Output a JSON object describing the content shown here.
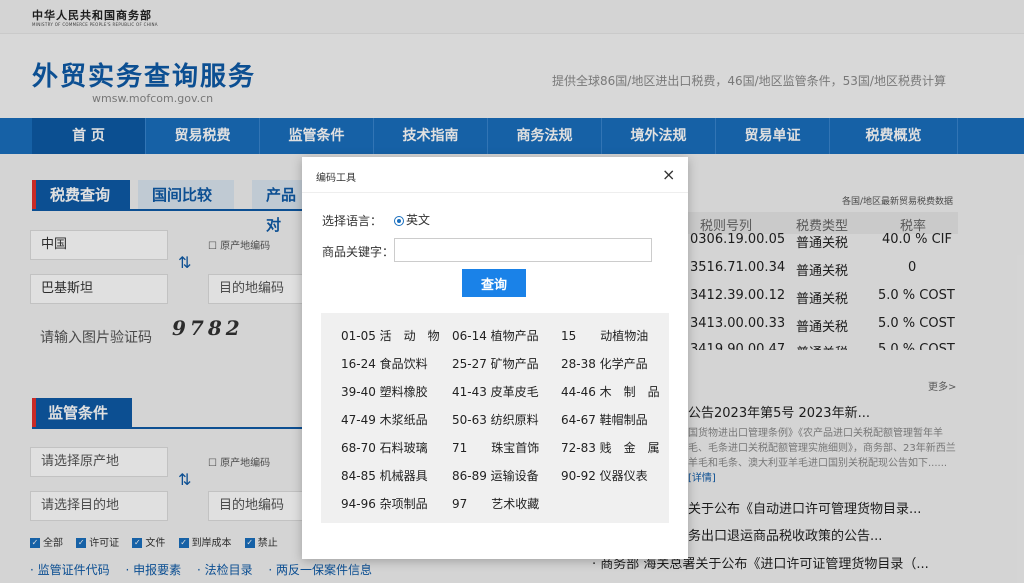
{
  "header": {
    "ministry_cn": "中华人民共和国商务部",
    "ministry_en": "MINISTRY OF COMMERCE PEOPLE'S REPUBLIC OF CHINA",
    "site_title": "外贸实务查询服务",
    "site_domain": "wmsw.mofcom.gov.cn",
    "slogan": "提供全球86国/地区进出口税费，46国/地区监管条件，53国/地区税费计算"
  },
  "nav": [
    "首 页",
    "贸易税费",
    "监管条件",
    "技术指南",
    "商务法规",
    "境外法规",
    "贸易单证",
    "税费概览"
  ],
  "tax_query": {
    "tabs": [
      "税费查询",
      "国间比较",
      "产品对"
    ],
    "origin_value": "中国",
    "origin_code_label": "原产地编码",
    "dest_value": "巴基斯坦",
    "dest_code_label": "目的地编码",
    "captcha_placeholder": "请输入图片验证码",
    "captcha_text": "9782"
  },
  "supervision": {
    "title": "监管条件",
    "origin_placeholder": "请选择原产地",
    "origin_code_label": "原产地编码",
    "dest_placeholder": "请选择目的地",
    "dest_code_label": "目的地编码",
    "checkboxes": [
      "全部",
      "许可证",
      "文件",
      "到岸成本",
      "禁止"
    ],
    "links": [
      "· 监管证件代码",
      "· 申报要素",
      "· 法检目录",
      "· 两反一保案件信息"
    ]
  },
  "right_panel": {
    "note": "各国/地区最新贸易税费数据",
    "table_headers": [
      "税则号列",
      "税费类型",
      "税率"
    ],
    "rows": [
      {
        "code": "0306.19.00.05",
        "type": "普通关税",
        "rate": "40.0 % CIF"
      },
      {
        "code": "3516.71.00.34",
        "type": "普通关税",
        "rate": "0"
      },
      {
        "code": "3412.39.00.12",
        "type": "普通关税",
        "rate": "5.0 % COST"
      },
      {
        "code": "3413.00.00.33",
        "type": "普通关税",
        "rate": "5.0 % COST"
      },
      {
        "code": "3419.90.00.47",
        "type": "普通关税",
        "rate": "5.0 % COST"
      }
    ],
    "more": "更多>",
    "news1_title": "公告2023年第5号 2023年新...",
    "news1_body": "国货物进出口管理条例》《农产品进口关税配额管理暂年羊毛、毛条进口关税配额管理实施细则》，商务部、23年新西兰羊毛和毛条、澳大利亚羊毛进口国别关税配现公告如下......",
    "news1_detail": "[详情]",
    "news2_title": "关于公布《自动进口许可管理货物目录...",
    "news3_title": "务出口退运商品税收政策的公告...",
    "news4_title": "· 商务部 海关总署关于公布《进口许可证管理货物目录（..."
  },
  "modal": {
    "title": "编码工具",
    "close": "×",
    "lang_label": "选择语言：",
    "lang_option": "英文",
    "keyword_label": "商品关键字：",
    "keyword_value": "",
    "keyword_placeholder": "",
    "query_button": "查询",
    "categories": [
      "01-05 活　动　物",
      "06-14 植物产品",
      "15　　动植物油",
      "16-24 食品饮料",
      "25-27 矿物产品",
      "28-38 化学产品",
      "39-40 塑料橡胶",
      "41-43 皮革皮毛",
      "44-46 木　制　品",
      "47-49 木浆纸品",
      "50-63 纺织原料",
      "64-67 鞋帽制品",
      "68-70 石料玻璃",
      "71　　珠宝首饰",
      "72-83 贱　金　属",
      "84-85 机械器具",
      "86-89 运输设备",
      "90-92 仪器仪表",
      "94-96 杂项制品",
      "97　　艺术收藏"
    ]
  }
}
